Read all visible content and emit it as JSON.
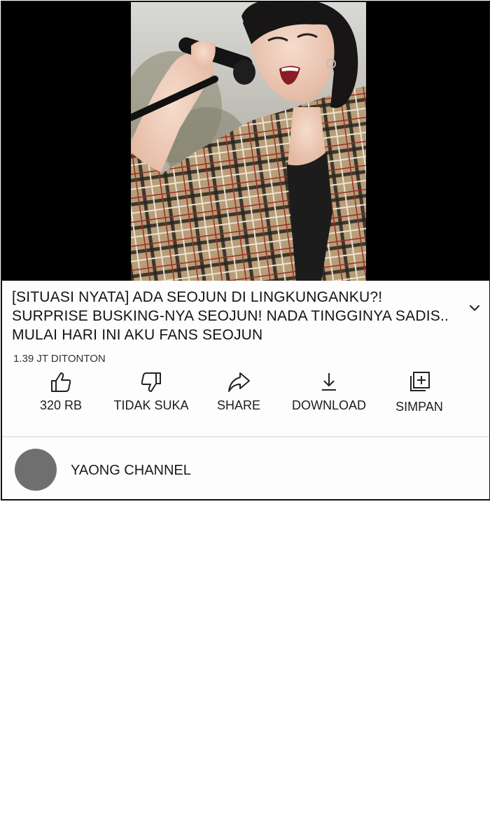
{
  "video": {
    "title": "[SITUASI NYATA] ADA SEOJUN DI LINGKUNGANKU?!\nSURPRISE BUSKING-NYA SEOJUN! NADA TINGGINYA SADIS..\nMULAI HARI INI AKU FANS SEOJUN",
    "views": "1.39 JT DITONTON"
  },
  "actions": {
    "like": {
      "label": "320 RB",
      "icon": "thumbs-up-icon"
    },
    "dislike": {
      "label": "TIDAK SUKA",
      "icon": "thumbs-down-icon"
    },
    "share": {
      "label": "SHARE",
      "icon": "share-arrow-icon"
    },
    "download": {
      "label": "DOWNLOAD",
      "icon": "download-icon"
    },
    "save": {
      "label": "SIMPAN",
      "icon": "add-to-playlist-icon"
    }
  },
  "channel": {
    "name": "YAONG CHANNEL"
  },
  "colors": {
    "player_bg": "#000000",
    "avatar": "#6f6f6f",
    "text": "#1a1a1a"
  }
}
